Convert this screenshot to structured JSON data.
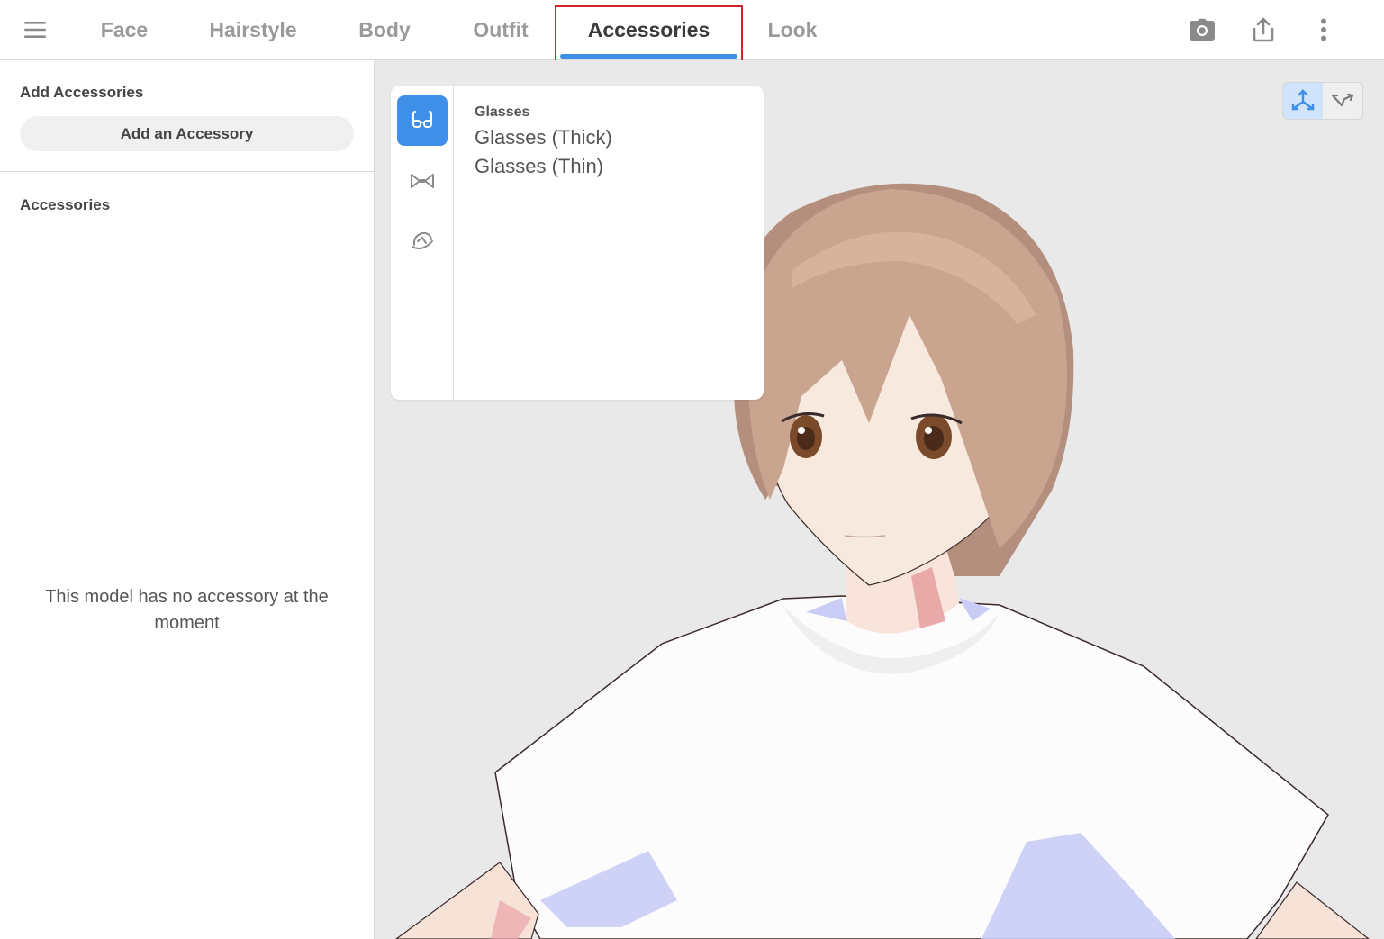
{
  "tabs": [
    {
      "label": "Face"
    },
    {
      "label": "Hairstyle"
    },
    {
      "label": "Body"
    },
    {
      "label": "Outfit"
    },
    {
      "label": "Accessories"
    },
    {
      "label": "Look"
    }
  ],
  "active_tab": "Accessories",
  "top_icons": [
    "menu-icon",
    "camera-icon",
    "share-icon",
    "more-vertical-icon"
  ],
  "left_panel": {
    "add_section_title": "Add Accessories",
    "add_button_label": "Add an Accessory",
    "list_section_title": "Accessories",
    "empty_message": "This model has no accessory at the moment"
  },
  "popup": {
    "categories": [
      "glasses-icon",
      "bow-tie-icon",
      "hat-icon"
    ],
    "title": "Glasses",
    "items": [
      "Glasses (Thick)",
      "Glasses (Thin)"
    ]
  },
  "view_toggle": [
    "axes-icon",
    "hand-pose-icon"
  ],
  "colors": {
    "accent": "#3f8fe8",
    "highlight_border": "#d0242b",
    "viewport_bg": "#e9e9e9",
    "hair": "#c9a48e",
    "eye": "#7a4a2a"
  }
}
